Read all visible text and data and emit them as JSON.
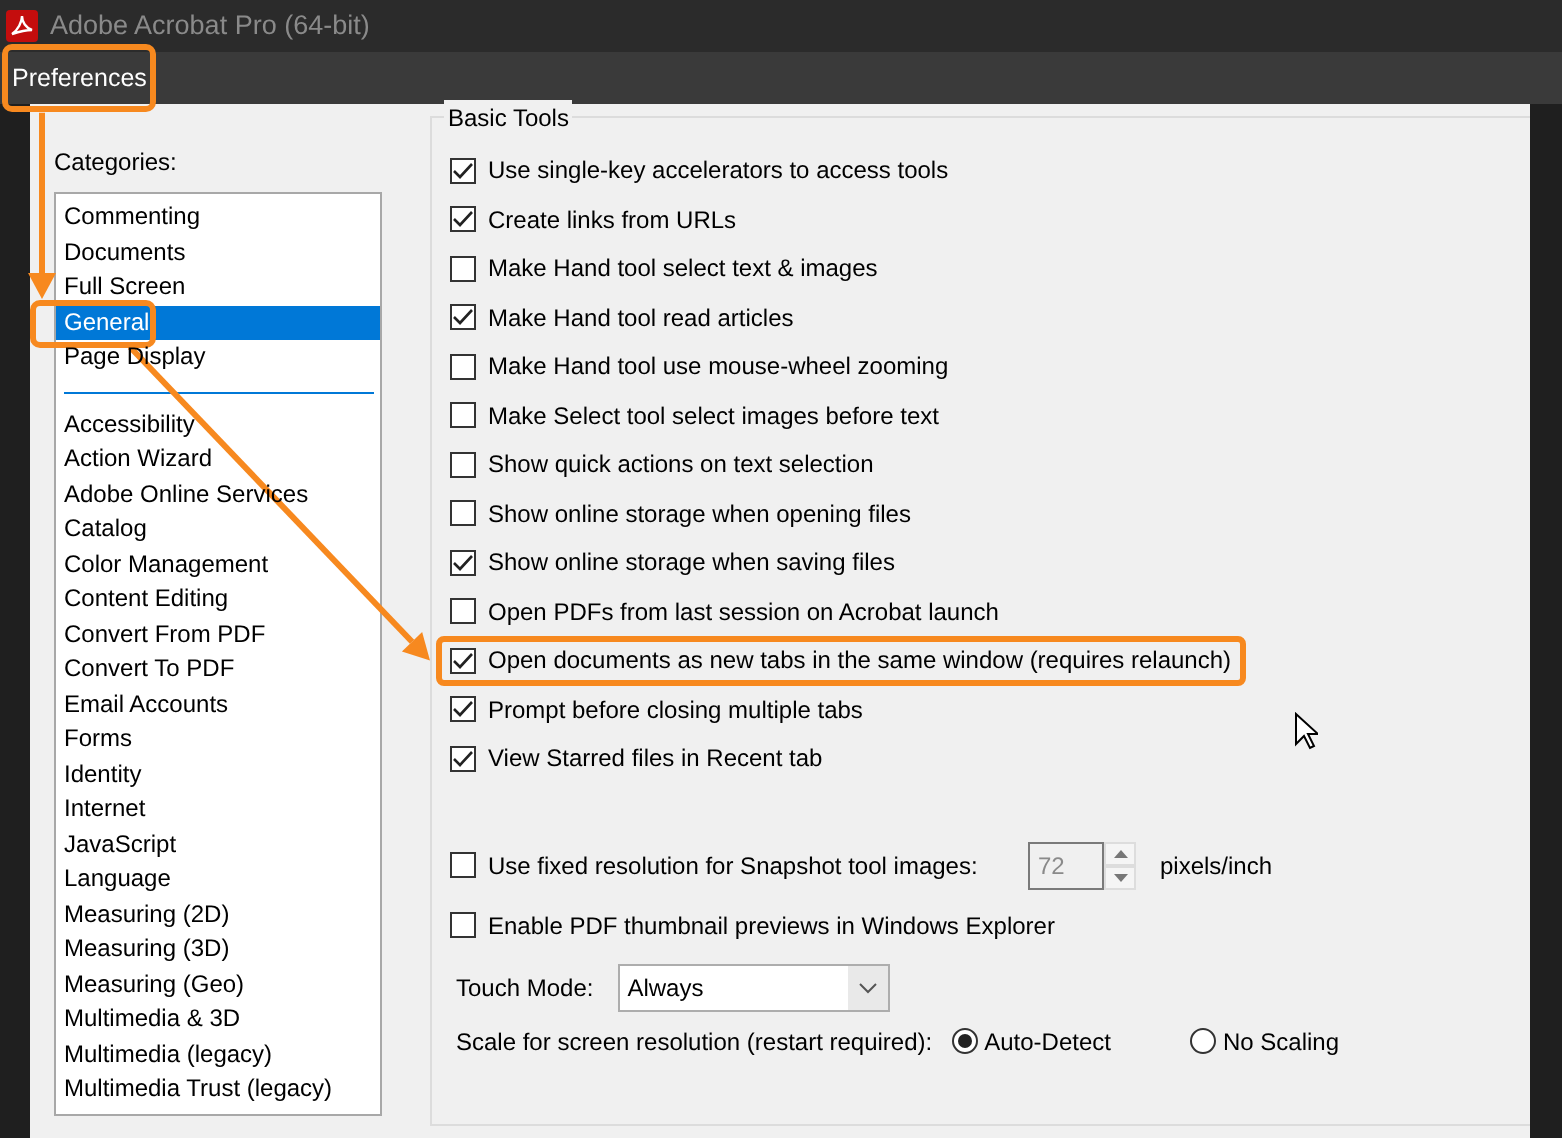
{
  "window": {
    "title": "Adobe Acrobat Pro (64-bit)"
  },
  "menu": {
    "label": "Preferences",
    "highlighted": true
  },
  "categories": {
    "label": "Categories:",
    "groups": [
      [
        {
          "label": "Commenting",
          "selected": false,
          "highlighted": false
        },
        {
          "label": "Documents",
          "selected": false,
          "highlighted": false
        },
        {
          "label": "Full Screen",
          "selected": false,
          "highlighted": false
        },
        {
          "label": "General",
          "selected": true,
          "highlighted": true
        },
        {
          "label": "Page Display",
          "selected": false,
          "highlighted": false
        }
      ],
      [
        {
          "label": "Accessibility",
          "selected": false,
          "highlighted": false
        },
        {
          "label": "Action Wizard",
          "selected": false,
          "highlighted": false
        },
        {
          "label": "Adobe Online Services",
          "selected": false,
          "highlighted": false
        },
        {
          "label": "Catalog",
          "selected": false,
          "highlighted": false
        },
        {
          "label": "Color Management",
          "selected": false,
          "highlighted": false
        },
        {
          "label": "Content Editing",
          "selected": false,
          "highlighted": false
        },
        {
          "label": "Convert From PDF",
          "selected": false,
          "highlighted": false
        },
        {
          "label": "Convert To PDF",
          "selected": false,
          "highlighted": false
        },
        {
          "label": "Email Accounts",
          "selected": false,
          "highlighted": false
        },
        {
          "label": "Forms",
          "selected": false,
          "highlighted": false
        },
        {
          "label": "Identity",
          "selected": false,
          "highlighted": false
        },
        {
          "label": "Internet",
          "selected": false,
          "highlighted": false
        },
        {
          "label": "JavaScript",
          "selected": false,
          "highlighted": false
        },
        {
          "label": "Language",
          "selected": false,
          "highlighted": false
        },
        {
          "label": "Measuring (2D)",
          "selected": false,
          "highlighted": false
        },
        {
          "label": "Measuring (3D)",
          "selected": false,
          "highlighted": false
        },
        {
          "label": "Measuring (Geo)",
          "selected": false,
          "highlighted": false
        },
        {
          "label": "Multimedia & 3D",
          "selected": false,
          "highlighted": false
        },
        {
          "label": "Multimedia (legacy)",
          "selected": false,
          "highlighted": false
        },
        {
          "label": "Multimedia Trust (legacy)",
          "selected": false,
          "highlighted": false
        }
      ]
    ]
  },
  "basic_tools": {
    "title": "Basic Tools",
    "options": [
      {
        "label": "Use single-key accelerators to access tools",
        "checked": true,
        "highlighted": false
      },
      {
        "label": "Create links from URLs",
        "checked": true,
        "highlighted": false
      },
      {
        "label": "Make Hand tool select text & images",
        "checked": false,
        "highlighted": false
      },
      {
        "label": "Make Hand tool read articles",
        "checked": true,
        "highlighted": false
      },
      {
        "label": "Make Hand tool use mouse-wheel zooming",
        "checked": false,
        "highlighted": false
      },
      {
        "label": "Make Select tool select images before text",
        "checked": false,
        "highlighted": false
      },
      {
        "label": "Show quick actions on text selection",
        "checked": false,
        "highlighted": false
      },
      {
        "label": "Show online storage when opening files",
        "checked": false,
        "highlighted": false
      },
      {
        "label": "Show online storage when saving files",
        "checked": true,
        "highlighted": false
      },
      {
        "label": "Open PDFs from last session on Acrobat launch",
        "checked": false,
        "highlighted": false
      },
      {
        "label": "Open documents as new tabs in the same window (requires relaunch)",
        "checked": true,
        "highlighted": true
      },
      {
        "label": "Prompt before closing multiple tabs",
        "checked": true,
        "highlighted": false
      },
      {
        "label": "View Starred files in Recent tab",
        "checked": true,
        "highlighted": false
      }
    ],
    "snapshot": {
      "label": "Use fixed resolution for Snapshot tool images:",
      "checked": false,
      "value": "72",
      "disabled": true,
      "unit": "pixels/inch"
    },
    "thumbnails": {
      "label": "Enable PDF thumbnail previews in Windows Explorer",
      "checked": false
    },
    "touch_mode": {
      "label": "Touch Mode:",
      "value": "Always"
    },
    "scale": {
      "label": "Scale for screen resolution (restart required):",
      "options": [
        {
          "label": "Auto-Detect",
          "selected": true
        },
        {
          "label": "No Scaling",
          "selected": false
        }
      ]
    }
  }
}
